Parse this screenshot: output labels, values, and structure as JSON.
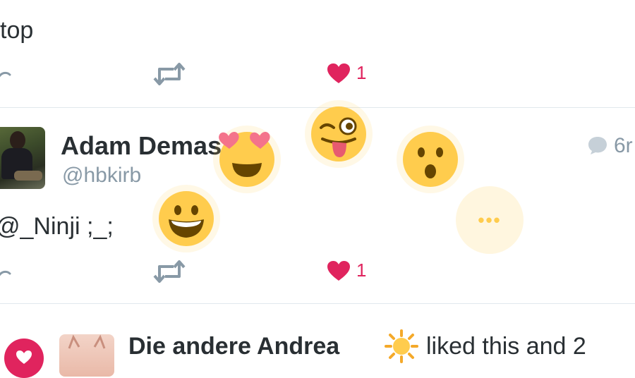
{
  "tweet_top": {
    "text_fragment": "top",
    "like_count": "1"
  },
  "tweet_main": {
    "author_name": "Adam Demas",
    "handle": "@hbkirb",
    "time": "6r",
    "text_fragment": "@_Ninji ;_;",
    "like_count": "1"
  },
  "reaction_picker": {
    "reactions": [
      "grinning-face",
      "heart-eyes-face",
      "winking-tongue-face",
      "surprised-face",
      "more"
    ],
    "more_label": "•••"
  },
  "activity": {
    "liker_name": "Die andere Andrea",
    "liked_text": "liked this and 2"
  },
  "colors": {
    "like_red": "#e0245e",
    "muted_gray": "#8899a6",
    "emoji_yellow": "#ffcc4d",
    "heart_pink": "#f4738b"
  }
}
